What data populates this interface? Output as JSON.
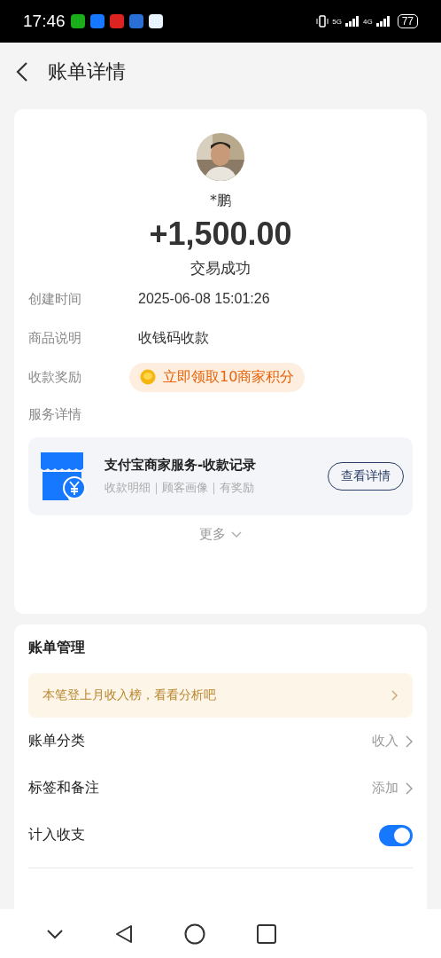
{
  "status_bar": {
    "time": "17:46",
    "network_1": "5G",
    "network_2": "4G",
    "battery": "77"
  },
  "header": {
    "title": "账单详情"
  },
  "summary": {
    "name": "*鹏",
    "amount": "+1,500.00",
    "status": "交易成功"
  },
  "details": [
    {
      "label": "创建时间",
      "value": "2025-06-08 15:01:26",
      "kind": "text"
    },
    {
      "label": "商品说明",
      "value": "收钱码收款",
      "kind": "text"
    },
    {
      "label": "收款奖励",
      "value": "立即领取10商家积分",
      "kind": "reward"
    }
  ],
  "service": {
    "label": "服务详情",
    "title": "支付宝商家服务-收款记录",
    "subtitle": "收款明细｜顾客画像｜有奖励",
    "button": "查看详情"
  },
  "more": "更多",
  "management": {
    "title": "账单管理",
    "banner": "本笔登上月收入榜，看看分析吧",
    "rows": [
      {
        "label": "账单分类",
        "value": "收入",
        "kind": "link"
      },
      {
        "label": "标签和备注",
        "value": "添加",
        "kind": "link"
      },
      {
        "label": "计入收支",
        "kind": "toggle",
        "on": true
      }
    ]
  }
}
